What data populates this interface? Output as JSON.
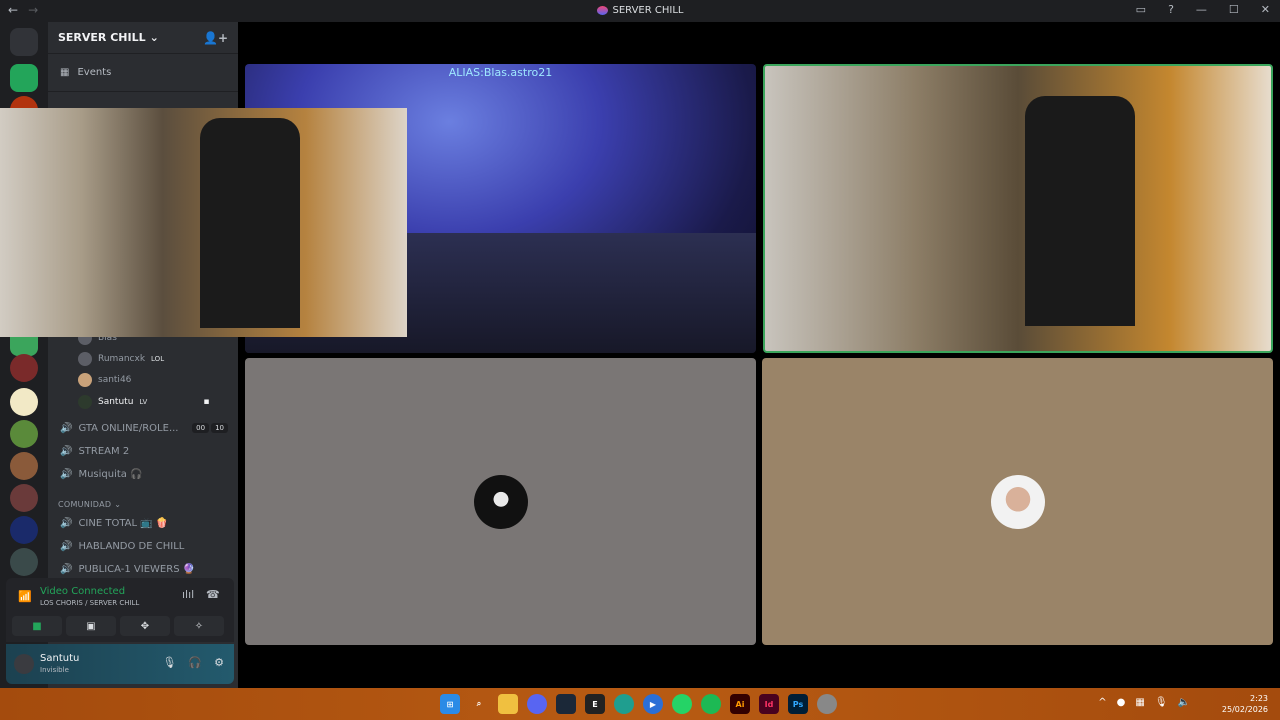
{
  "window": {
    "title": "SERVER CHILL"
  },
  "server": {
    "name": "SERVER CHILL",
    "events_label": "Events"
  },
  "members": [
    {
      "name": "Blas",
      "tag": ""
    },
    {
      "name": "Rumancxk",
      "tag": "LOL"
    },
    {
      "name": "santi46",
      "tag": ""
    },
    {
      "name": "Santutu",
      "tag": "LV"
    }
  ],
  "channels": [
    {
      "name": "GTA ONLINE/ROLE...",
      "count_a": "00",
      "count_b": "10"
    },
    {
      "name": "STREAM 2"
    },
    {
      "name": "Musiquita 🎧"
    }
  ],
  "category": {
    "name": "COMUNIDAD"
  },
  "community_channels": [
    {
      "name": "CINE TOTAL 📺 🍿"
    },
    {
      "name": "HABLANDO DE CHILL"
    },
    {
      "name": "PUBLICA-1 VIEWERS 🔮"
    }
  ],
  "voice": {
    "status": "Video Connected",
    "location": "LOS CHORIS / SERVER CHILL"
  },
  "user": {
    "name": "Santutu",
    "status": "Invisible"
  },
  "stream": {
    "alias_label": "ALIAS:Blas.astro21"
  },
  "clock": {
    "time": "2:23",
    "date": "25/02/2026"
  },
  "taskbar_apps": [
    "windows-icon",
    "search-icon",
    "folder-icon",
    "discord-icon",
    "steam-icon",
    "epic-icon",
    "edge-icon",
    "media-icon",
    "whatsapp-icon",
    "spotify-icon",
    "illustrator-icon",
    "indesign-icon",
    "photoshop-icon",
    "chrome-icon"
  ],
  "colors": {
    "accent_green": "#23a55a",
    "sidebar": "#2b2d31",
    "rail": "#1e1f22",
    "taskbar": "#b85b13"
  }
}
